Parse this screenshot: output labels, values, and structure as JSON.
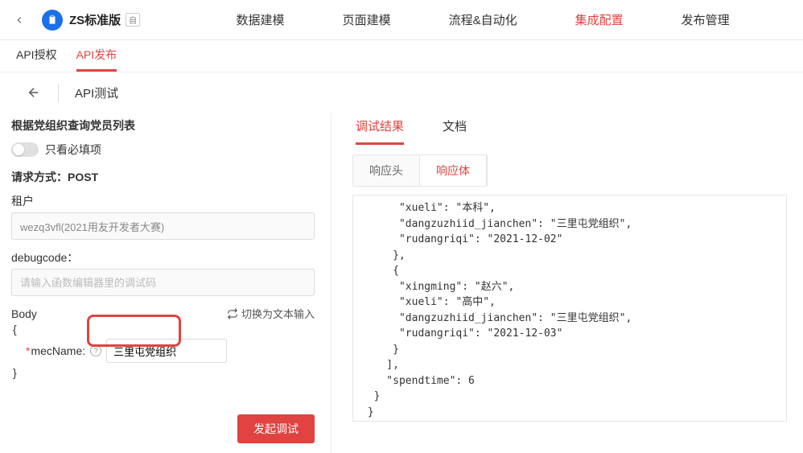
{
  "header": {
    "brand_name": "ZS标准版",
    "brand_badge": "自",
    "nav": [
      {
        "label": "数据建模"
      },
      {
        "label": "页面建模"
      },
      {
        "label": "流程&自动化"
      },
      {
        "label": "集成配置",
        "active": true
      },
      {
        "label": "发布管理"
      }
    ]
  },
  "subnav": [
    {
      "label": "API授权"
    },
    {
      "label": "API发布",
      "active": true
    }
  ],
  "page": {
    "title": "API测试"
  },
  "left": {
    "api_desc": "根据党组织查询党员列表",
    "only_required_label": "只看必填项",
    "method_label": "请求方式：",
    "method_value": "POST",
    "tenant_label": "租户",
    "tenant_value": "wezq3vfl(2021用友开发者大赛)",
    "debugcode_label": "debugcode：",
    "debugcode_placeholder": "请输入函数编辑器里的调试码",
    "body_label": "Body",
    "switch_text_label": "切换为文本输入",
    "open_brace": "{",
    "close_brace": "}",
    "body_param_key": "mecName:",
    "body_param_value": "三里屯党组织",
    "submit_label": "发起调试"
  },
  "right": {
    "result_tabs": [
      {
        "label": "调试结果",
        "active": true
      },
      {
        "label": "文档"
      }
    ],
    "resp_tabs": [
      {
        "label": "响应头"
      },
      {
        "label": "响应体",
        "active": true
      }
    ],
    "response_body": "      \"xueli\": \"本科\",\n      \"dangzuzhiid_jianchen\": \"三里屯党组织\",\n      \"rudangriqi\": \"2021-12-02\"\n     },\n     {\n      \"xingming\": \"赵六\",\n      \"xueli\": \"高中\",\n      \"dangzuzhiid_jianchen\": \"三里屯党组织\",\n      \"rudangriqi\": \"2021-12-03\"\n     }\n    ],\n    \"spendtime\": 6\n  }\n }"
  }
}
